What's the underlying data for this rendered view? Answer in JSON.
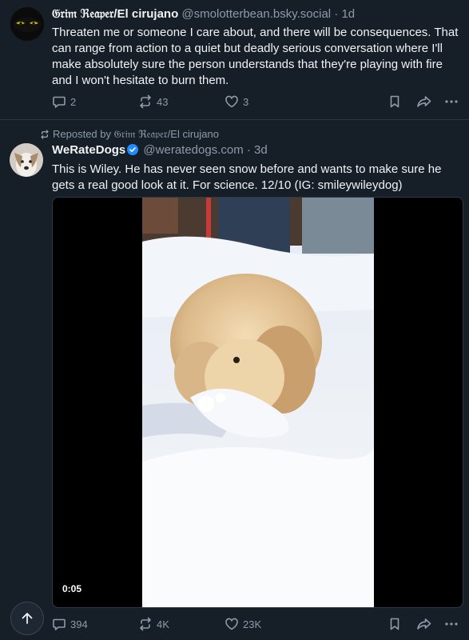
{
  "post1": {
    "display_name": "𝔊𝔯𝔦𝔪 ℜ𝔢𝔞𝔭𝔢𝔯/El cirujano",
    "handle": "@smolotterbean.bsky.social",
    "separator": "·",
    "time": "1d",
    "text": "Threaten me or someone I care about, and there will be consequences. That can range from action to a quiet but deadly serious conversation where I'll make absolutely sure the person understands that they're playing with fire and I won't hesitate to burn them.",
    "replies": "2",
    "reposts": "43",
    "likes": "3"
  },
  "post2": {
    "repost_label": "Reposted by 𝔊𝔯𝔦𝔪 ℜ𝔢𝔞𝔭𝔢𝔯/El cirujano",
    "display_name": "WeRateDogs",
    "handle": "@weratedogs.com",
    "separator": "·",
    "time": "3d",
    "text": "This is Wiley. He has never seen snow before and wants to make sure he gets a real good look at it. For science. 12/10 (IG: smileywileydog)",
    "video_duration": "0:05",
    "replies": "394",
    "reposts": "4K",
    "likes": "23K"
  },
  "colors": {
    "background": "#161e27",
    "text": "#f1f3f5",
    "muted": "#8d9bab",
    "verified": "#208bfe"
  },
  "icons": [
    "reply-icon",
    "repost-icon",
    "like-icon",
    "bookmark-icon",
    "share-icon",
    "more-icon",
    "verified-badge-icon",
    "arrow-up-icon"
  ]
}
